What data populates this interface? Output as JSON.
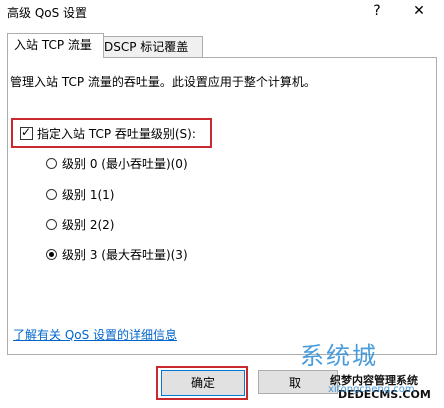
{
  "window": {
    "title": "高级 QoS 设置",
    "help_glyph": "?",
    "close_glyph": "✕"
  },
  "tabs": [
    {
      "label": "入站 TCP 流量",
      "active": true
    },
    {
      "label": "DSCP 标记覆盖",
      "active": false
    }
  ],
  "panel": {
    "description": "管理入站 TCP 流量的吞吐量。此设置应用于整个计算机。",
    "checkbox_label": "指定入站 TCP 吞吐量级别(S):",
    "checkbox_checked": true,
    "options": [
      {
        "label": "级别 0 (最小吞吐量)(0)",
        "selected": false
      },
      {
        "label": "级别 1(1)",
        "selected": false
      },
      {
        "label": "级别 2(2)",
        "selected": false
      },
      {
        "label": "级别 3 (最大吞吐量)(3)",
        "selected": true
      }
    ],
    "link": "了解有关 QoS 设置的详细信息"
  },
  "buttons": {
    "ok": "确定",
    "cancel": "取"
  },
  "watermark": {
    "logo": "系统城",
    "site1": "织梦内容管理系统",
    "site2": "DEDECMS.COM",
    "domain": "xitongcheng.com"
  },
  "colors": {
    "highlight_border": "#c8282e",
    "link": "#0066cc",
    "accent": "#0078d7"
  }
}
